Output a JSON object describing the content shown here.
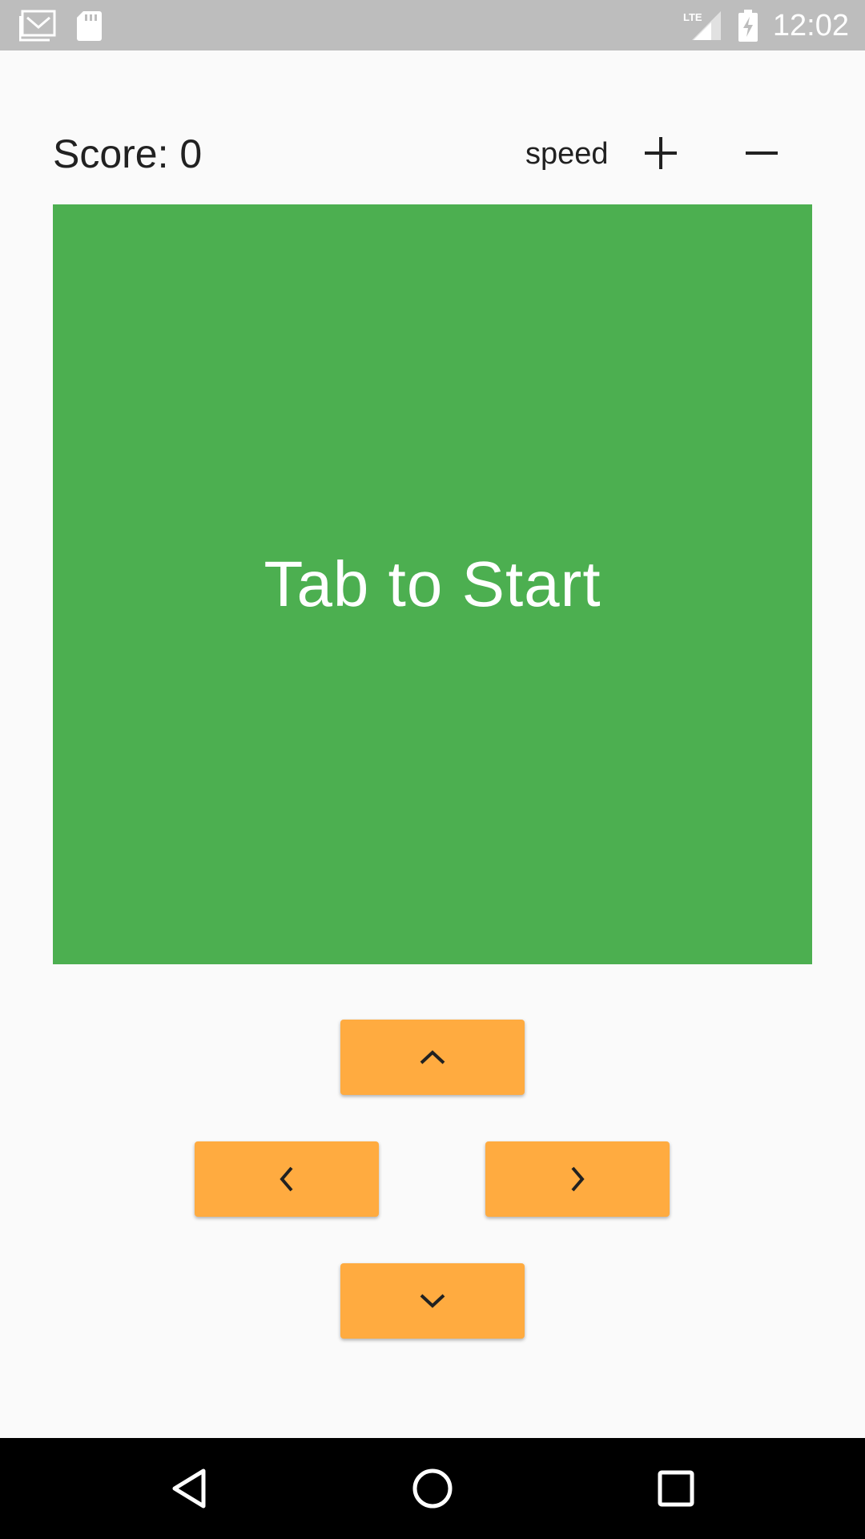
{
  "status_bar": {
    "time": "12:02",
    "network": "LTE",
    "icons": [
      "gmail-icon",
      "sd-card-icon",
      "lte-signal-icon",
      "battery-charging-icon"
    ]
  },
  "header": {
    "score_label": "Score: 0",
    "speed_label": "speed",
    "speed_increase_icon": "plus-icon",
    "speed_decrease_icon": "minus-icon"
  },
  "board": {
    "message": "Tab to Start",
    "color": "#4caf50"
  },
  "controls": {
    "button_color": "#ffab40",
    "up_icon": "chevron-up-icon",
    "left_icon": "chevron-left-icon",
    "right_icon": "chevron-right-icon",
    "down_icon": "chevron-down-icon"
  },
  "nav_bar": {
    "icons": [
      "back-icon",
      "home-icon",
      "recents-icon"
    ]
  }
}
